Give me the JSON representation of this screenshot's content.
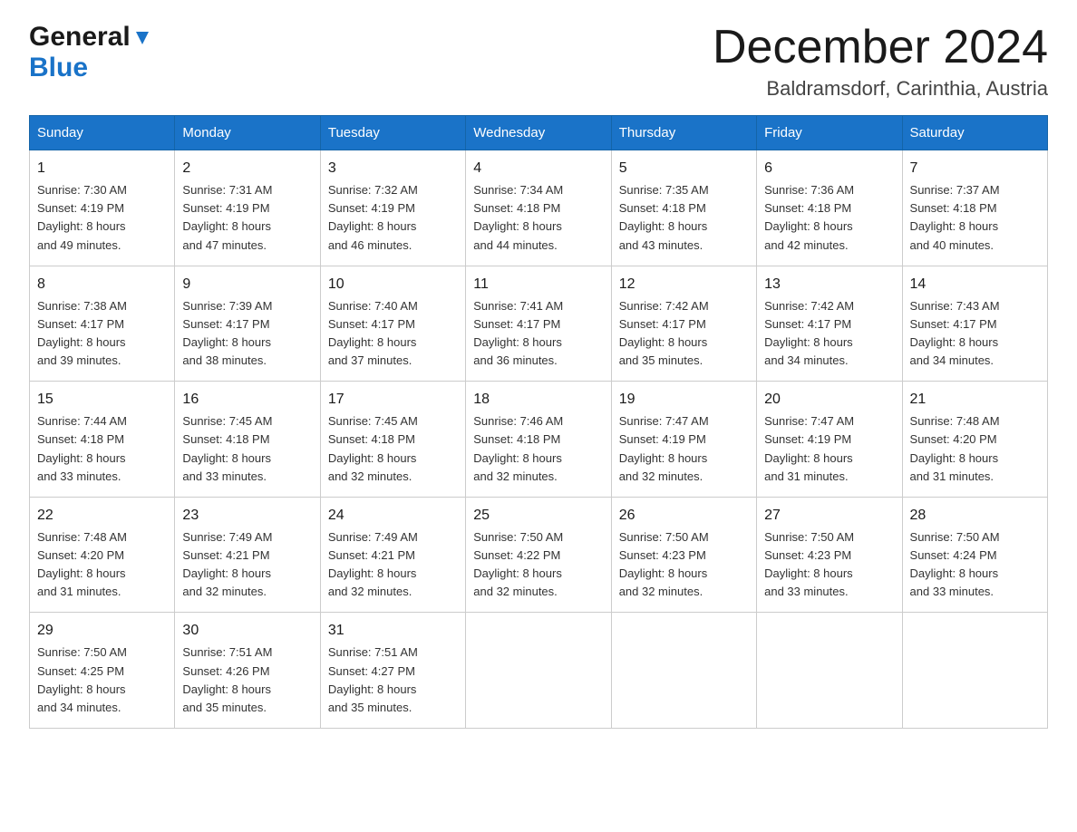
{
  "header": {
    "logo_general": "General",
    "logo_blue": "Blue",
    "month_title": "December 2024",
    "location": "Baldramsdorf, Carinthia, Austria"
  },
  "weekdays": [
    "Sunday",
    "Monday",
    "Tuesday",
    "Wednesday",
    "Thursday",
    "Friday",
    "Saturday"
  ],
  "weeks": [
    [
      {
        "day": "1",
        "sunrise": "7:30 AM",
        "sunset": "4:19 PM",
        "daylight": "8 hours and 49 minutes."
      },
      {
        "day": "2",
        "sunrise": "7:31 AM",
        "sunset": "4:19 PM",
        "daylight": "8 hours and 47 minutes."
      },
      {
        "day": "3",
        "sunrise": "7:32 AM",
        "sunset": "4:19 PM",
        "daylight": "8 hours and 46 minutes."
      },
      {
        "day": "4",
        "sunrise": "7:34 AM",
        "sunset": "4:18 PM",
        "daylight": "8 hours and 44 minutes."
      },
      {
        "day": "5",
        "sunrise": "7:35 AM",
        "sunset": "4:18 PM",
        "daylight": "8 hours and 43 minutes."
      },
      {
        "day": "6",
        "sunrise": "7:36 AM",
        "sunset": "4:18 PM",
        "daylight": "8 hours and 42 minutes."
      },
      {
        "day": "7",
        "sunrise": "7:37 AM",
        "sunset": "4:18 PM",
        "daylight": "8 hours and 40 minutes."
      }
    ],
    [
      {
        "day": "8",
        "sunrise": "7:38 AM",
        "sunset": "4:17 PM",
        "daylight": "8 hours and 39 minutes."
      },
      {
        "day": "9",
        "sunrise": "7:39 AM",
        "sunset": "4:17 PM",
        "daylight": "8 hours and 38 minutes."
      },
      {
        "day": "10",
        "sunrise": "7:40 AM",
        "sunset": "4:17 PM",
        "daylight": "8 hours and 37 minutes."
      },
      {
        "day": "11",
        "sunrise": "7:41 AM",
        "sunset": "4:17 PM",
        "daylight": "8 hours and 36 minutes."
      },
      {
        "day": "12",
        "sunrise": "7:42 AM",
        "sunset": "4:17 PM",
        "daylight": "8 hours and 35 minutes."
      },
      {
        "day": "13",
        "sunrise": "7:42 AM",
        "sunset": "4:17 PM",
        "daylight": "8 hours and 34 minutes."
      },
      {
        "day": "14",
        "sunrise": "7:43 AM",
        "sunset": "4:17 PM",
        "daylight": "8 hours and 34 minutes."
      }
    ],
    [
      {
        "day": "15",
        "sunrise": "7:44 AM",
        "sunset": "4:18 PM",
        "daylight": "8 hours and 33 minutes."
      },
      {
        "day": "16",
        "sunrise": "7:45 AM",
        "sunset": "4:18 PM",
        "daylight": "8 hours and 33 minutes."
      },
      {
        "day": "17",
        "sunrise": "7:45 AM",
        "sunset": "4:18 PM",
        "daylight": "8 hours and 32 minutes."
      },
      {
        "day": "18",
        "sunrise": "7:46 AM",
        "sunset": "4:18 PM",
        "daylight": "8 hours and 32 minutes."
      },
      {
        "day": "19",
        "sunrise": "7:47 AM",
        "sunset": "4:19 PM",
        "daylight": "8 hours and 32 minutes."
      },
      {
        "day": "20",
        "sunrise": "7:47 AM",
        "sunset": "4:19 PM",
        "daylight": "8 hours and 31 minutes."
      },
      {
        "day": "21",
        "sunrise": "7:48 AM",
        "sunset": "4:20 PM",
        "daylight": "8 hours and 31 minutes."
      }
    ],
    [
      {
        "day": "22",
        "sunrise": "7:48 AM",
        "sunset": "4:20 PM",
        "daylight": "8 hours and 31 minutes."
      },
      {
        "day": "23",
        "sunrise": "7:49 AM",
        "sunset": "4:21 PM",
        "daylight": "8 hours and 32 minutes."
      },
      {
        "day": "24",
        "sunrise": "7:49 AM",
        "sunset": "4:21 PM",
        "daylight": "8 hours and 32 minutes."
      },
      {
        "day": "25",
        "sunrise": "7:50 AM",
        "sunset": "4:22 PM",
        "daylight": "8 hours and 32 minutes."
      },
      {
        "day": "26",
        "sunrise": "7:50 AM",
        "sunset": "4:23 PM",
        "daylight": "8 hours and 32 minutes."
      },
      {
        "day": "27",
        "sunrise": "7:50 AM",
        "sunset": "4:23 PM",
        "daylight": "8 hours and 33 minutes."
      },
      {
        "day": "28",
        "sunrise": "7:50 AM",
        "sunset": "4:24 PM",
        "daylight": "8 hours and 33 minutes."
      }
    ],
    [
      {
        "day": "29",
        "sunrise": "7:50 AM",
        "sunset": "4:25 PM",
        "daylight": "8 hours and 34 minutes."
      },
      {
        "day": "30",
        "sunrise": "7:51 AM",
        "sunset": "4:26 PM",
        "daylight": "8 hours and 35 minutes."
      },
      {
        "day": "31",
        "sunrise": "7:51 AM",
        "sunset": "4:27 PM",
        "daylight": "8 hours and 35 minutes."
      },
      null,
      null,
      null,
      null
    ]
  ],
  "labels": {
    "sunrise": "Sunrise:",
    "sunset": "Sunset:",
    "daylight": "Daylight:"
  }
}
